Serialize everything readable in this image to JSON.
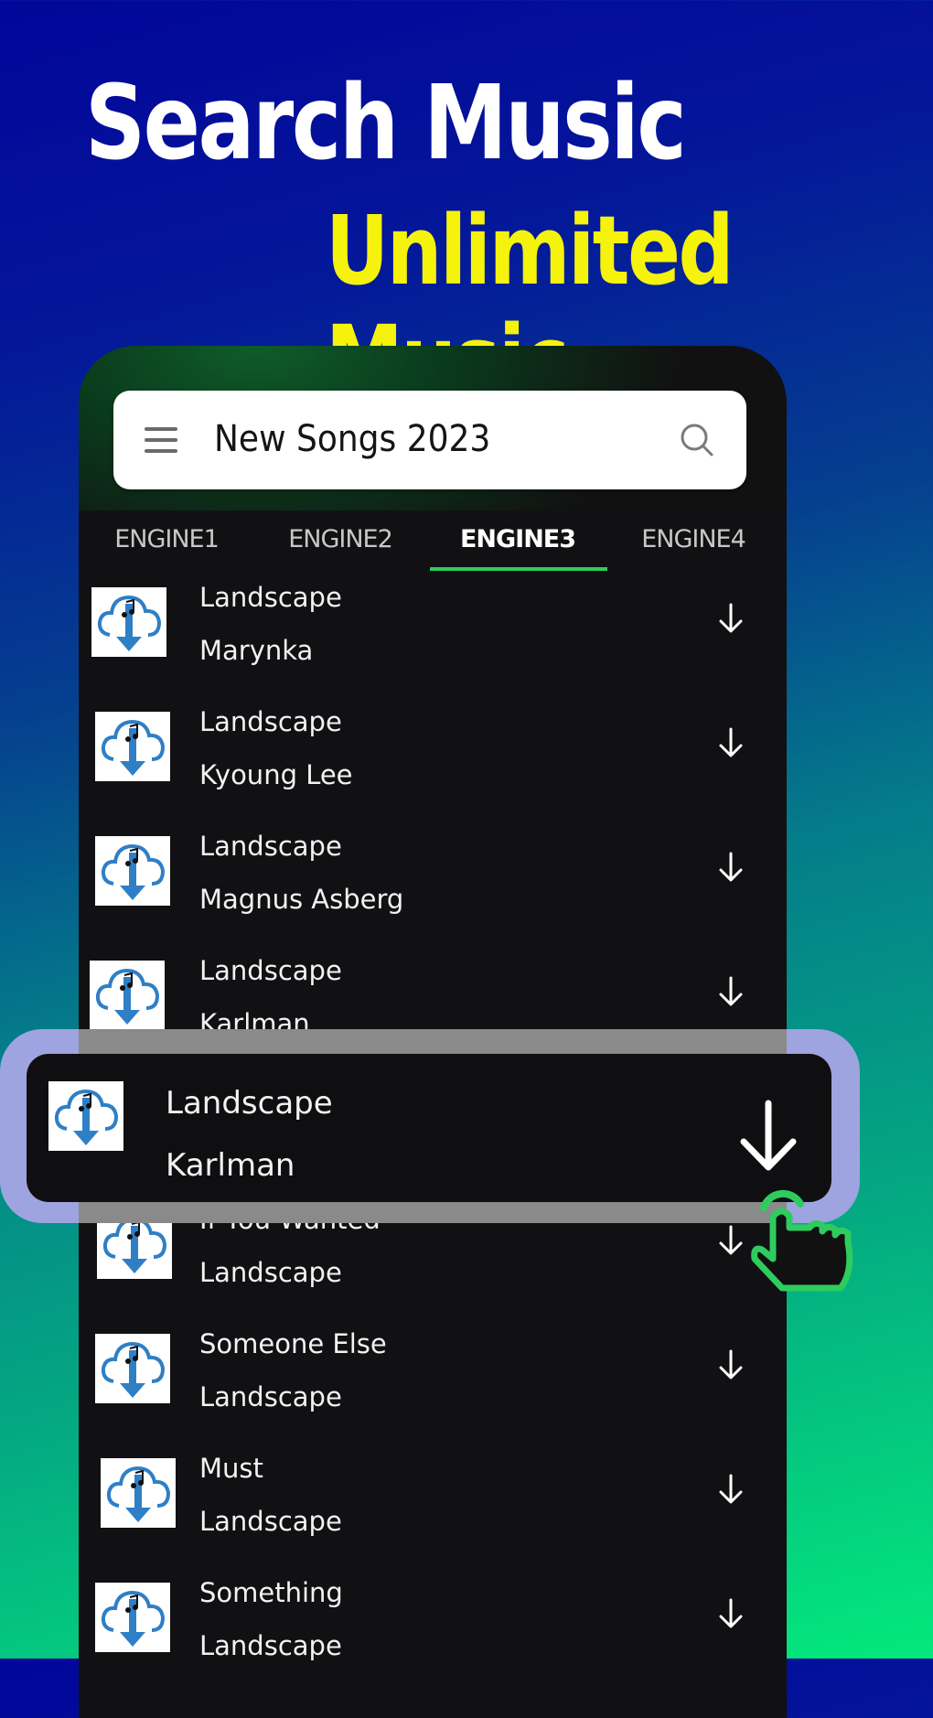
{
  "headline": {
    "line1": "Search Music",
    "line2": "Unlimited Music",
    "line1_color": "#ffffff",
    "line2_color": "#f5f20c"
  },
  "search": {
    "menu_icon": "hamburger-menu-icon",
    "value": "New Songs 2023",
    "search_icon": "magnifier-icon"
  },
  "tabs": [
    {
      "label": "ENGINE1",
      "active": false
    },
    {
      "label": "ENGINE2",
      "active": false
    },
    {
      "label": "ENGINE3",
      "active": true
    },
    {
      "label": "ENGINE4",
      "active": false
    }
  ],
  "accent_color": "#2ecc5e",
  "songs": [
    {
      "title": "Landscape",
      "artist": "Marynka",
      "icon": "cloud-music-download-icon",
      "action_icon": "download-arrow-icon"
    },
    {
      "title": "Landscape",
      "artist": "Kyoung Lee",
      "icon": "cloud-music-download-icon",
      "action_icon": "download-arrow-icon"
    },
    {
      "title": "Landscape",
      "artist": "Magnus Asberg",
      "icon": "cloud-music-download-icon",
      "action_icon": "download-arrow-icon"
    },
    {
      "title": "Landscape",
      "artist": "Karlman",
      "icon": "cloud-music-download-icon",
      "action_icon": "download-arrow-icon"
    },
    {
      "title": "If You Wanted",
      "artist": "Landscape",
      "icon": "cloud-music-download-icon",
      "action_icon": "download-arrow-icon"
    },
    {
      "title": "Someone Else",
      "artist": "Landscape",
      "icon": "cloud-music-download-icon",
      "action_icon": "download-arrow-icon"
    },
    {
      "title": "Must",
      "artist": "Landscape",
      "icon": "cloud-music-download-icon",
      "action_icon": "download-arrow-icon"
    },
    {
      "title": "Something",
      "artist": "Landscape",
      "icon": "cloud-music-download-icon",
      "action_icon": "download-arrow-icon"
    }
  ],
  "highlighted": {
    "title": "Landscape",
    "artist": "Karlman",
    "action_icon": "download-arrow-icon",
    "pointer_icon": "tap-hand-icon"
  }
}
